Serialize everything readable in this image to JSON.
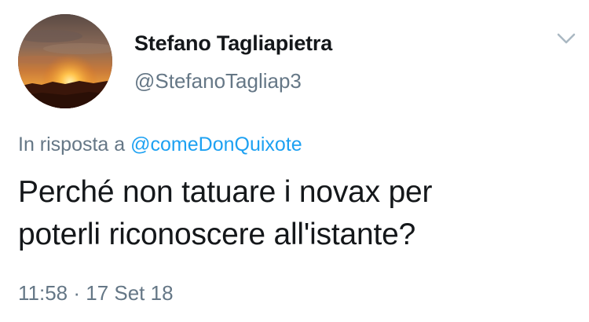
{
  "tweet": {
    "author": {
      "name": "Stefano Tagliapietra",
      "handle": "@StefanoTagliap3",
      "avatar_icon": "sunset-avatar"
    },
    "menu_icon": "chevron-down-icon",
    "reply": {
      "prefix": "In risposta a",
      "mention": "@comeDonQuixote"
    },
    "text_lines": [
      "Perché non tatuare i novax per",
      "poterli riconoscere all'istante?"
    ],
    "timestamp": "11:58 · 17 Set 18",
    "colors": {
      "link": "#1da1f2",
      "secondary": "#657786",
      "primary": "#14171a"
    }
  }
}
